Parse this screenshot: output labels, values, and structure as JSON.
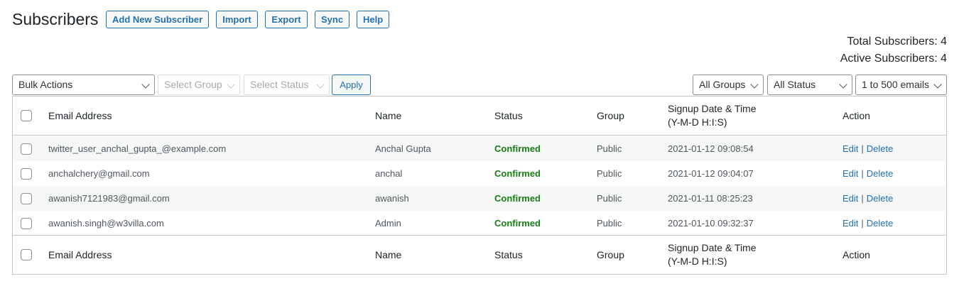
{
  "page": {
    "title": "Subscribers"
  },
  "header_buttons": [
    "Add New Subscriber",
    "Import",
    "Export",
    "Sync",
    "Help"
  ],
  "stats": {
    "total": "Total Subscribers: 4",
    "active": "Active Subscribers: 4"
  },
  "filters": {
    "bulk_actions": "Bulk Actions",
    "select_group": "Select Group",
    "select_status": "Select Status",
    "apply": "Apply",
    "all_groups": "All Groups",
    "all_status": "All Status",
    "per_page": "1 to 500 emails"
  },
  "table": {
    "columns": {
      "email": "Email Address",
      "name": "Name",
      "status": "Status",
      "group": "Group",
      "signup_line1": "Signup Date & Time",
      "signup_line2": "(Y-M-D H:I:S)",
      "action": "Action"
    },
    "rows": [
      {
        "email": "twitter_user_anchal_gupta_@example.com",
        "name": "Anchal Gupta",
        "status": "Confirmed",
        "group": "Public",
        "signup": "2021-01-12 09:08:54",
        "edit": "Edit",
        "sep": "|",
        "delete": "Delete"
      },
      {
        "email": "anchalchery@gmail.com",
        "name": "anchal",
        "status": "Confirmed",
        "group": "Public",
        "signup": "2021-01-12 09:04:07",
        "edit": "Edit",
        "sep": "|",
        "delete": "Delete"
      },
      {
        "email": "awanish7121983@gmail.com",
        "name": "awanish",
        "status": "Confirmed",
        "group": "Public",
        "signup": "2021-01-11 08:25:23",
        "edit": "Edit",
        "sep": "|",
        "delete": "Delete"
      },
      {
        "email": "awanish.singh@w3villa.com",
        "name": "Admin",
        "status": "Confirmed",
        "group": "Public",
        "signup": "2021-01-10 09:32:37",
        "edit": "Edit",
        "sep": "|",
        "delete": "Delete"
      }
    ]
  },
  "colors": {
    "accent": "#2271b1",
    "confirmed": "#1a7d17",
    "alt_row": "#f6f7f7",
    "border": "#c3c4c7"
  }
}
